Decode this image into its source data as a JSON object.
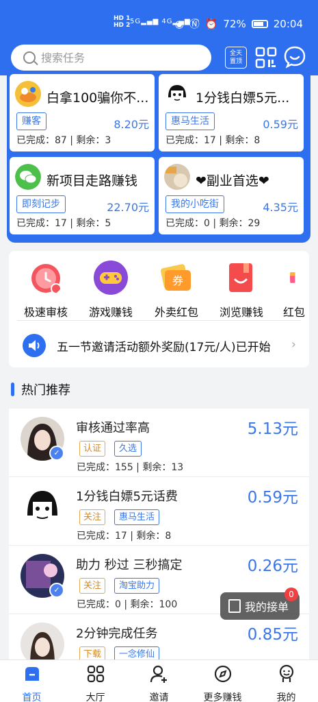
{
  "status_bar": {
    "sim1": "HD 1",
    "sim2": "HD 2",
    "net1": "5G",
    "net2": "4G",
    "battery": "72%",
    "time": "20:04"
  },
  "header": {
    "search_placeholder": "搜索任务",
    "pin_label_1": "全天",
    "pin_label_2": "置顶"
  },
  "top_cards": [
    {
      "title": "白拿100骗你不...",
      "tag": "赚客",
      "price": "8.20元",
      "stat": "已完成：87 | 剩余：3"
    },
    {
      "title": "1分钱白嫖5元...",
      "tag": "惠马生活",
      "price": "0.59元",
      "stat": "已完成：17 | 剩余：8"
    },
    {
      "title": "新项目走路赚钱",
      "tag": "即刻记步",
      "price": "22.70元",
      "stat": "已完成：17 | 剩余：5"
    },
    {
      "title": "❤副业首选❤",
      "tag": "我的小吃街",
      "price": "4.35元",
      "stat": "已完成：0 | 剩余：29"
    }
  ],
  "categories": [
    {
      "label": "极速审核"
    },
    {
      "label": "游戏赚钱"
    },
    {
      "label": "外卖红包"
    },
    {
      "label": "浏览赚钱"
    },
    {
      "label": "红包"
    }
  ],
  "coupon_glyph": "券",
  "notice": "五一节邀请活动额外奖励(17元/人)已开始",
  "section_title": "热门推荐",
  "hot_list": [
    {
      "name": "审核通过率高",
      "price": "5.13元",
      "tag1": "认证",
      "tag2": "久选",
      "stat": "已完成：155 | 剩余：13",
      "verified": true
    },
    {
      "name": "1分钱白嫖5元话费",
      "price": "0.59元",
      "tag1": "关注",
      "tag2": "惠马生活",
      "stat": "已完成：17 | 剩余：8",
      "verified": false
    },
    {
      "name": "助力 秒过 三秒搞定",
      "price": "0.26元",
      "tag1": "关注",
      "tag2": "淘宝助力",
      "stat": "已完成：0 | 剩余：100",
      "verified": true
    },
    {
      "name": "2分钟完成任务",
      "price": "0.85元",
      "tag1": "下载",
      "tag2": "一念修仙",
      "stat": "",
      "verified": false
    }
  ],
  "float_button": {
    "label": "我的接单",
    "badge": "0"
  },
  "tabs": [
    {
      "label": "首页",
      "active": true
    },
    {
      "label": "大厅"
    },
    {
      "label": "邀请"
    },
    {
      "label": "更多赚钱"
    },
    {
      "label": "我的"
    }
  ],
  "colors": {
    "primary": "#2e6ff0",
    "price": "#3a76e8",
    "tag_orange": "#d58a2a"
  }
}
